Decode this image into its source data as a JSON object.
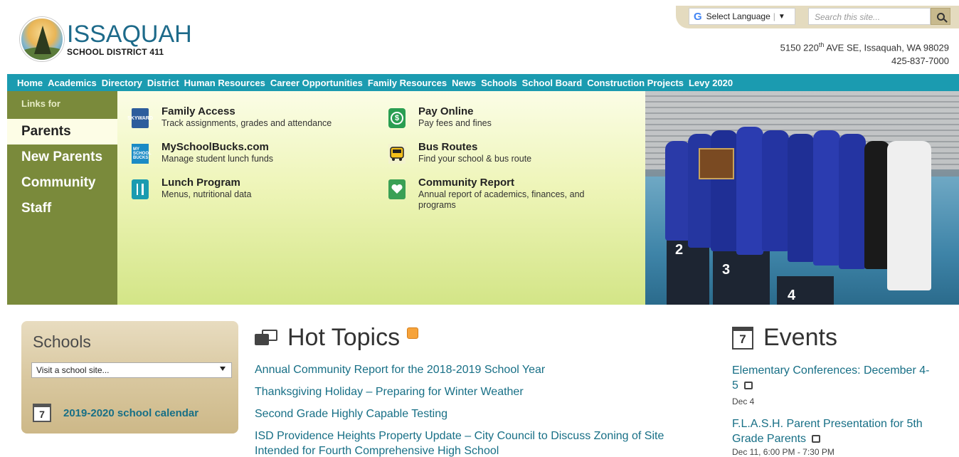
{
  "header": {
    "logo_name": "ISSAQUAH",
    "logo_sub": "SCHOOL DISTRICT 411",
    "language_label": "Select Language",
    "search_placeholder": "Search this site...",
    "address_line1_pre": "5150 220",
    "address_line1_sup": "th",
    "address_line1_post": " AVE SE, Issaquah, WA 98029",
    "address_line2": "425-837-7000"
  },
  "nav": {
    "items": [
      "Home",
      "Academics",
      "Directory",
      "District",
      "Human Resources",
      "Career Opportunities",
      "Family Resources",
      "News",
      "Schools",
      "School Board",
      "Construction Projects",
      "Levy 2020"
    ]
  },
  "links_side": {
    "heading": "Links for",
    "items": [
      "Parents",
      "New Parents",
      "Community",
      "Staff"
    ]
  },
  "quick_links": [
    {
      "title": "Family Access",
      "desc": "Track assignments, grades and attendance",
      "icon": "family-access-icon"
    },
    {
      "title": "MySchoolBucks.com",
      "desc": "Manage student lunch funds",
      "icon": "myschoolbucks-icon"
    },
    {
      "title": "Lunch Program",
      "desc": "Menus, nutritional data",
      "icon": "utensils-icon"
    },
    {
      "title": "Pay Online",
      "desc": "Pay fees and fines",
      "icon": "dollar-icon"
    },
    {
      "title": "Bus Routes",
      "desc": "Find your school & bus route",
      "icon": "bus-icon"
    },
    {
      "title": "Community Report",
      "desc": "Annual report of academics, finances, and programs",
      "icon": "heart-icon"
    }
  ],
  "icon_text": {
    "family_access": "SKYWARD",
    "msb_lines": [
      "MY",
      "SCHOOL",
      "BUCKS"
    ],
    "pay_symbol": "$"
  },
  "photo": {
    "podium_numbers": [
      "2",
      "3",
      "4"
    ]
  },
  "schools": {
    "title": "Schools",
    "select_value": "Visit a school site...",
    "calendar_day": "7",
    "calendar_link": "2019-2020 school calendar"
  },
  "hot_topics": {
    "title": "Hot Topics",
    "items": [
      "Annual Community Report for the 2018-2019 School Year",
      "Thanksgiving Holiday – Preparing for Winter Weather",
      "Second Grade Highly Capable Testing",
      "ISD Providence Heights Property Update – City Council to Discuss Zoning of Site",
      "Intended for Fourth Comprehensive High School"
    ]
  },
  "events": {
    "title": "Events",
    "calendar_day": "7",
    "items": [
      {
        "title_line1": "Elementary Conferences: December 4-",
        "title_line2": "5",
        "date": "Dec 4"
      },
      {
        "title_line1": "F.L.A.S.H. Parent Presentation for 5th",
        "title_line2": "Grade Parents",
        "date": "Dec 11, 6:00 PM - 7:30 PM"
      }
    ]
  },
  "colors": {
    "nav_bg": "#1b9bb0",
    "side_bg": "#7a8a3b",
    "link": "#176f86"
  }
}
